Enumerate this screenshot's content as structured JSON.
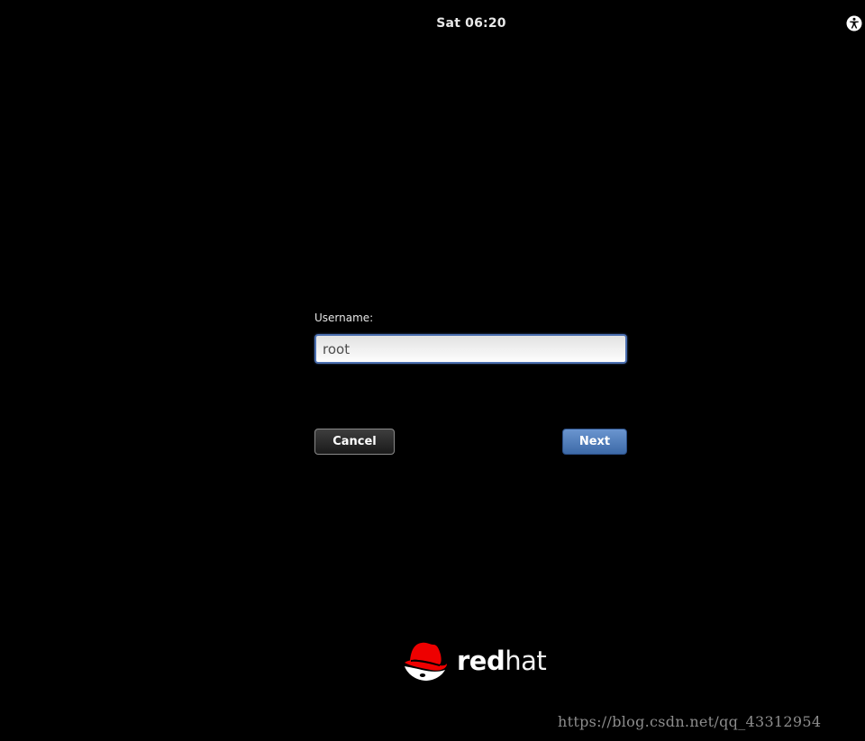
{
  "topbar": {
    "clock": "Sat 06:20",
    "accessibility_icon": "accessibility-icon"
  },
  "login": {
    "username_label": "Username:",
    "username_value": "root",
    "cancel_label": "Cancel",
    "next_label": "Next"
  },
  "brand": {
    "logo_icon": "redhat-shadowman-icon",
    "wordmark_bold": "red",
    "wordmark_light": "hat",
    "logo_red": "#ee0000"
  },
  "watermark": "https://blog.csdn.net/qq_43312954",
  "colors": {
    "background": "#000000",
    "next_button": "#4f7cbc",
    "input_border": "#4b6fb0"
  }
}
